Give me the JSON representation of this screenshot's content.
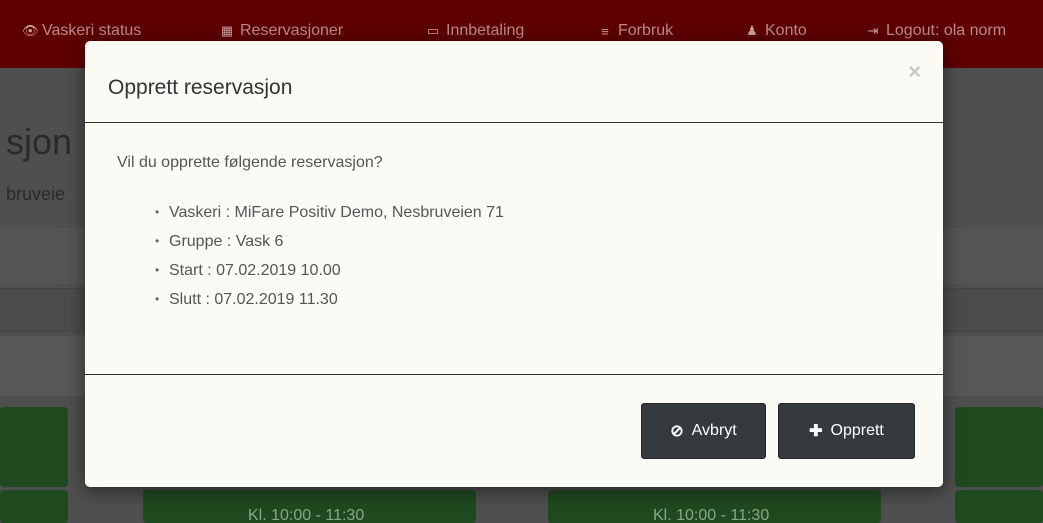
{
  "nav": {
    "items": [
      {
        "icon": "eye-icon",
        "glyph": "👁",
        "label": "Vaskeri status"
      },
      {
        "icon": "calendar-icon",
        "glyph": "▦",
        "label": "Reservasjoner"
      },
      {
        "icon": "credit-card-icon",
        "glyph": "▭",
        "label": "Innbetaling"
      },
      {
        "icon": "list-icon",
        "glyph": "≡",
        "label": "Forbruk"
      },
      {
        "icon": "user-icon",
        "glyph": "♟",
        "label": "Konto"
      },
      {
        "icon": "logout-icon",
        "glyph": "⇥",
        "label": "Logout: ola norm"
      }
    ]
  },
  "background": {
    "title_fragment": "sjon",
    "subtitle_fragment": "bruveie",
    "slots": [
      "Kl. 10:00 - 11:30",
      "Kl. 10:00 - 11:30"
    ]
  },
  "modal": {
    "title": "Opprett reservasjon",
    "close": "×",
    "question": "Vil du opprette følgende reservasjon?",
    "details": [
      "Vaskeri : MiFare Positiv Demo, Nesbruveien 71",
      "Gruppe : Vask 6",
      "Start : 07.02.2019 10.00",
      "Slutt : 07.02.2019 11.30"
    ],
    "cancel_label": "Avbryt",
    "cancel_icon": "⊘",
    "create_label": "Opprett",
    "create_icon": "✚"
  },
  "colors": {
    "nav_bg": "#cc0000",
    "modal_bg": "#fbfaf5",
    "button_bg": "#353a3f",
    "slot_green": "#3c8f3c"
  }
}
